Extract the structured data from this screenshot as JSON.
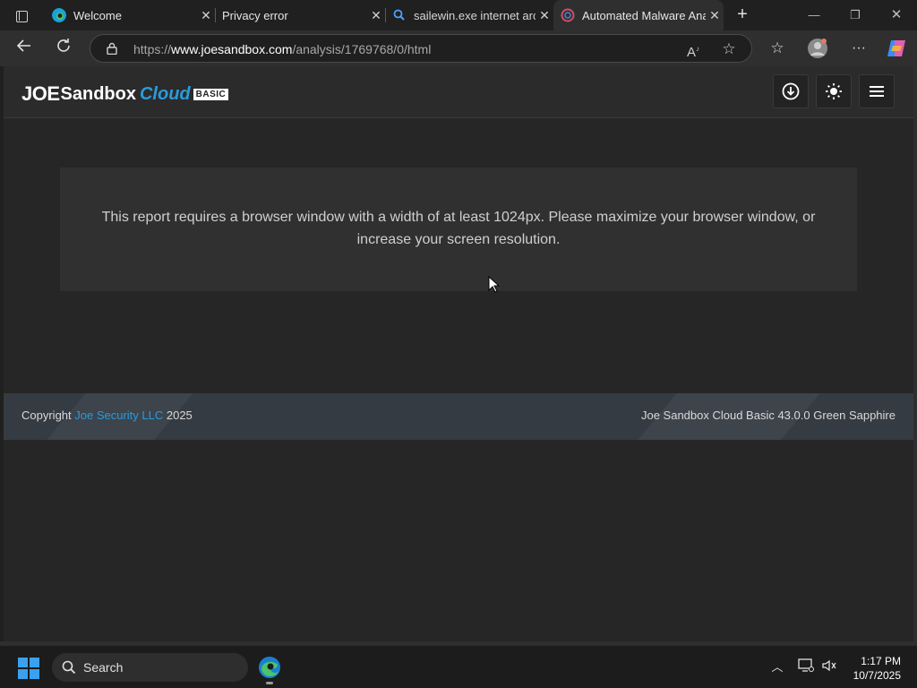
{
  "tabs": [
    {
      "title": "Welcome",
      "favicon": "edge-icon",
      "active": false
    },
    {
      "title": "Privacy error",
      "favicon": "none",
      "active": false
    },
    {
      "title": "sailewin.exe internet archive",
      "favicon": "search-icon",
      "active": false
    },
    {
      "title": "Automated Malware Analysis",
      "favicon": "joesandbox-icon",
      "active": true
    }
  ],
  "address_bar": {
    "scheme": "https://",
    "host": "www.joesandbox.com",
    "path": "/analysis/1769768/0/html"
  },
  "site": {
    "logo": {
      "joe": "JOE",
      "sandbox": "Sandbox",
      "cloud": "Cloud",
      "badge": "BASIC"
    },
    "header_buttons": [
      "download-icon",
      "sun-icon",
      "menu-icon"
    ]
  },
  "notice": {
    "message": "This report requires a browser window with a width of at least 1024px. Please maximize your browser window, or increase your screen resolution."
  },
  "footer": {
    "copyright_prefix": "Copyright ",
    "company": "Joe Security LLC",
    "year": " 2025",
    "version": "Joe Sandbox Cloud Basic 43.0.0 Green Sapphire"
  },
  "taskbar": {
    "search_label": "Search",
    "time": "1:17 PM",
    "date": "10/7/2025"
  },
  "colors": {
    "accent_blue": "#2a9bdc",
    "page_bg": "#262626",
    "footer_bg": "#353b42"
  }
}
